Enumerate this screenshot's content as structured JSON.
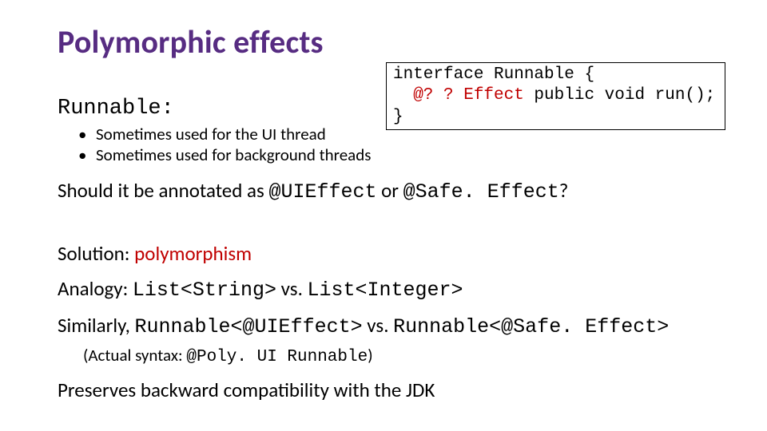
{
  "title": "Polymorphic effects",
  "codebox": {
    "line1_a": "interface Runnable {",
    "line2_annot": "@? ? Effect",
    "line2_rest": " public void run();",
    "line3": "}"
  },
  "subhead_pre": "Runnable",
  "subhead_post": ":",
  "bullets": [
    "Sometimes used for the UI thread",
    "Sometimes used for background threads"
  ],
  "q_pre": "Should it be annotated as ",
  "q_a": "@UIEffect",
  "q_mid": " or ",
  "q_b": "@Safe. Effect",
  "q_post": "?",
  "sol_label": "Solution:  ",
  "sol_word": "polymorphism",
  "ana_label": "Analogy:  ",
  "ana_a": "List<String>",
  "ana_vs": " vs. ",
  "ana_b": "List<Integer>",
  "sim_label": "Similarly, ",
  "sim_a": "Runnable<@UIEffect>",
  "sim_vs": " vs. ",
  "sim_b": "Runnable<@Safe. Effect>",
  "note_pre": "(Actual syntax: ",
  "note_code": "@Poly. UI Runnable",
  "note_post": ")",
  "last": "Preserves backward compatibility with the JDK"
}
